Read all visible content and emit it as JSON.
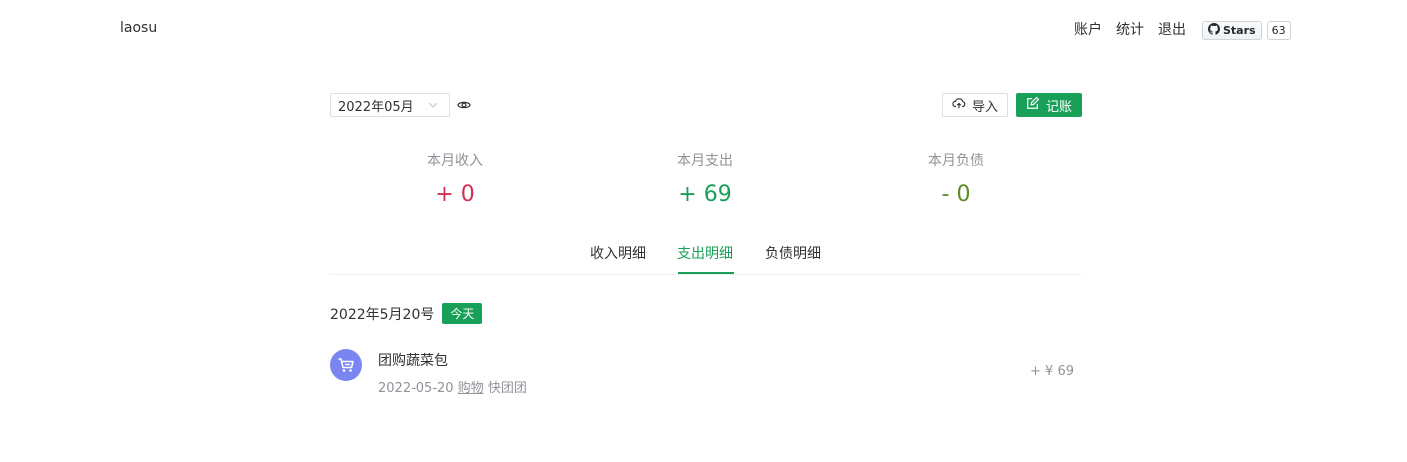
{
  "header": {
    "brand": "laosu",
    "nav": [
      "账户",
      "统计",
      "退出"
    ],
    "github": {
      "label": "Stars",
      "count": "63"
    }
  },
  "toolbar": {
    "month": "2022年05月",
    "import_label": "导入",
    "record_label": "记账"
  },
  "stats": [
    {
      "label": "本月收入",
      "value": "+ 0",
      "color": "#d03050"
    },
    {
      "label": "本月支出",
      "value": "+ 69",
      "color": "#18a058"
    },
    {
      "label": "本月负债",
      "value": "- 0",
      "color": "#5a8c23"
    }
  ],
  "tabs": {
    "items": [
      "收入明细",
      "支出明细",
      "负债明细"
    ],
    "active": "支出明细"
  },
  "group": {
    "date": "2022年5月20号",
    "badge": "今天"
  },
  "records": [
    {
      "title": "团购蔬菜包",
      "date": "2022-05-20",
      "category": "购物",
      "account": "快团团",
      "amount": "+ ¥ 69",
      "icon": "shopping-cart-icon"
    }
  ],
  "colors": {
    "accent": "#18a058",
    "income": "#d03050",
    "debt": "#5a8c23",
    "icon_bg": "#7b85f2"
  }
}
